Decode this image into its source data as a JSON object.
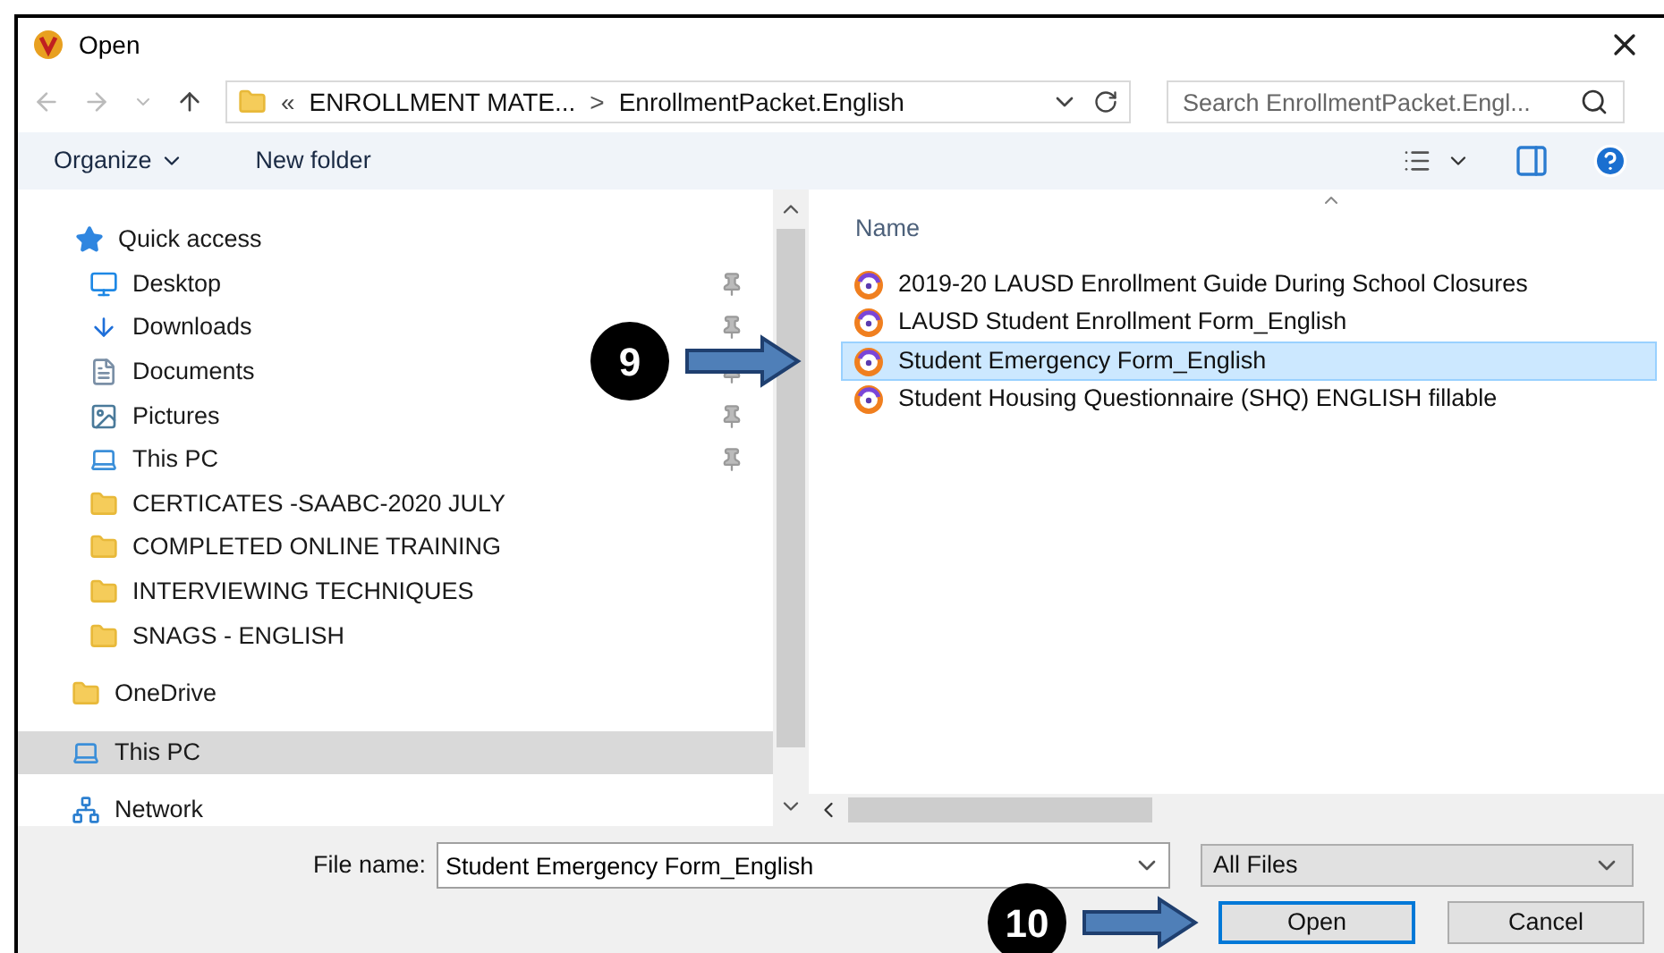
{
  "window": {
    "title": "Open"
  },
  "address": {
    "overflow": "«",
    "crumbs": [
      "ENROLLMENT MATE...",
      "EnrollmentPacket.English"
    ],
    "separator": ">"
  },
  "search": {
    "placeholder": "Search EnrollmentPacket.Engl..."
  },
  "toolbar": {
    "organize": "Organize",
    "new_folder": "New folder"
  },
  "sidebar": {
    "items": [
      {
        "label": "Quick access",
        "kind": "star",
        "selected": false,
        "children": [
          {
            "label": "Desktop",
            "kind": "desktop",
            "pinned": true,
            "selected": false
          },
          {
            "label": "Downloads",
            "kind": "download",
            "pinned": true,
            "selected": false
          },
          {
            "label": "Documents",
            "kind": "document",
            "pinned": true,
            "selected": false
          },
          {
            "label": "Pictures",
            "kind": "picture",
            "pinned": true,
            "selected": false
          },
          {
            "label": "This PC",
            "kind": "pc",
            "pinned": true,
            "selected": false
          },
          {
            "label": "CERTICATES -SAABC-2020 JULY",
            "kind": "folder",
            "pinned": false,
            "selected": false
          },
          {
            "label": "COMPLETED ONLINE TRAINING",
            "kind": "folder",
            "pinned": false,
            "selected": false
          },
          {
            "label": "INTERVIEWING TECHNIQUES",
            "kind": "folder",
            "pinned": false,
            "selected": false
          },
          {
            "label": "SNAGS - ENGLISH",
            "kind": "folder",
            "pinned": false,
            "selected": false
          }
        ]
      },
      {
        "label": "OneDrive",
        "kind": "folder",
        "selected": false
      },
      {
        "label": "This PC",
        "kind": "pc",
        "selected": true
      },
      {
        "label": "Network",
        "kind": "network",
        "selected": false
      }
    ]
  },
  "file_list": {
    "column": "Name",
    "files": [
      {
        "name": "2019-20 LAUSD Enrollment Guide During School Closures",
        "selected": false
      },
      {
        "name": "LAUSD Student Enrollment Form_English",
        "selected": false
      },
      {
        "name": "Student Emergency Form_English",
        "selected": true
      },
      {
        "name": "Student Housing Questionnaire (SHQ) ENGLISH fillable",
        "selected": false
      }
    ]
  },
  "file_name": {
    "label": "File name:",
    "value": "Student Emergency Form_English"
  },
  "file_type": {
    "value": "All Files"
  },
  "buttons": [
    {
      "label": "Open",
      "default": true
    },
    {
      "label": "Cancel",
      "default": false
    }
  ],
  "callouts": [
    {
      "number": "9"
    },
    {
      "number": "10"
    }
  ]
}
